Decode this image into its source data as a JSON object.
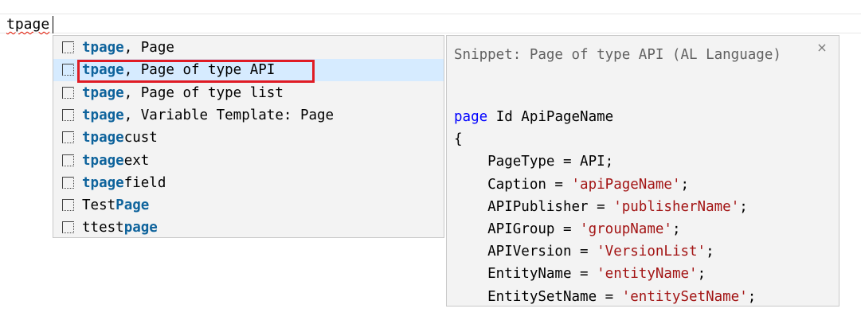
{
  "editor": {
    "typed_text": "tpage"
  },
  "suggestions": [
    {
      "match": "tpage",
      "rest": ", Page",
      "icon": "snippet-icon"
    },
    {
      "match": "tpage",
      "rest": ", Page of type API",
      "icon": "snippet-icon",
      "selected": true
    },
    {
      "match": "tpage",
      "rest": ", Page of type list",
      "icon": "snippet-icon"
    },
    {
      "match": "tpage",
      "rest": ", Variable Template: Page",
      "icon": "snippet-icon"
    },
    {
      "match": "tpage",
      "rest": "cust",
      "icon": "snippet-icon"
    },
    {
      "match": "tpage",
      "rest": "ext",
      "icon": "snippet-icon"
    },
    {
      "match": "tpage",
      "rest": "field",
      "icon": "snippet-icon"
    },
    {
      "pre": "Test",
      "match": "Page",
      "icon": "snippet-icon"
    },
    {
      "pre": "ttest",
      "match": "page",
      "icon": "snippet-icon"
    }
  ],
  "details": {
    "title": "Snippet: Page of type API (AL Language)",
    "close_glyph": "×",
    "code": [
      [
        {
          "t": "page",
          "c": "kw"
        },
        {
          "t": " Id ApiPageName"
        }
      ],
      [
        {
          "t": "{"
        }
      ],
      [
        {
          "t": "    PageType = API;"
        }
      ],
      [
        {
          "t": "    Caption = "
        },
        {
          "t": "'apiPageName'",
          "c": "str"
        },
        {
          "t": ";"
        }
      ],
      [
        {
          "t": "    APIPublisher = "
        },
        {
          "t": "'publisherName'",
          "c": "str"
        },
        {
          "t": ";"
        }
      ],
      [
        {
          "t": "    APIGroup = "
        },
        {
          "t": "'groupName'",
          "c": "str"
        },
        {
          "t": ";"
        }
      ],
      [
        {
          "t": "    APIVersion = "
        },
        {
          "t": "'VersionList'",
          "c": "str"
        },
        {
          "t": ";"
        }
      ],
      [
        {
          "t": "    EntityName = "
        },
        {
          "t": "'entityName'",
          "c": "str"
        },
        {
          "t": ";"
        }
      ],
      [
        {
          "t": "    EntitySetName = "
        },
        {
          "t": "'entitySetName'",
          "c": "str"
        },
        {
          "t": ";"
        }
      ]
    ]
  },
  "colors": {
    "match_highlight": "#0e639c",
    "selected_row": "#d6ebff",
    "annotation_box": "#e01b24",
    "keyword": "#0000ff",
    "string": "#a31515"
  }
}
